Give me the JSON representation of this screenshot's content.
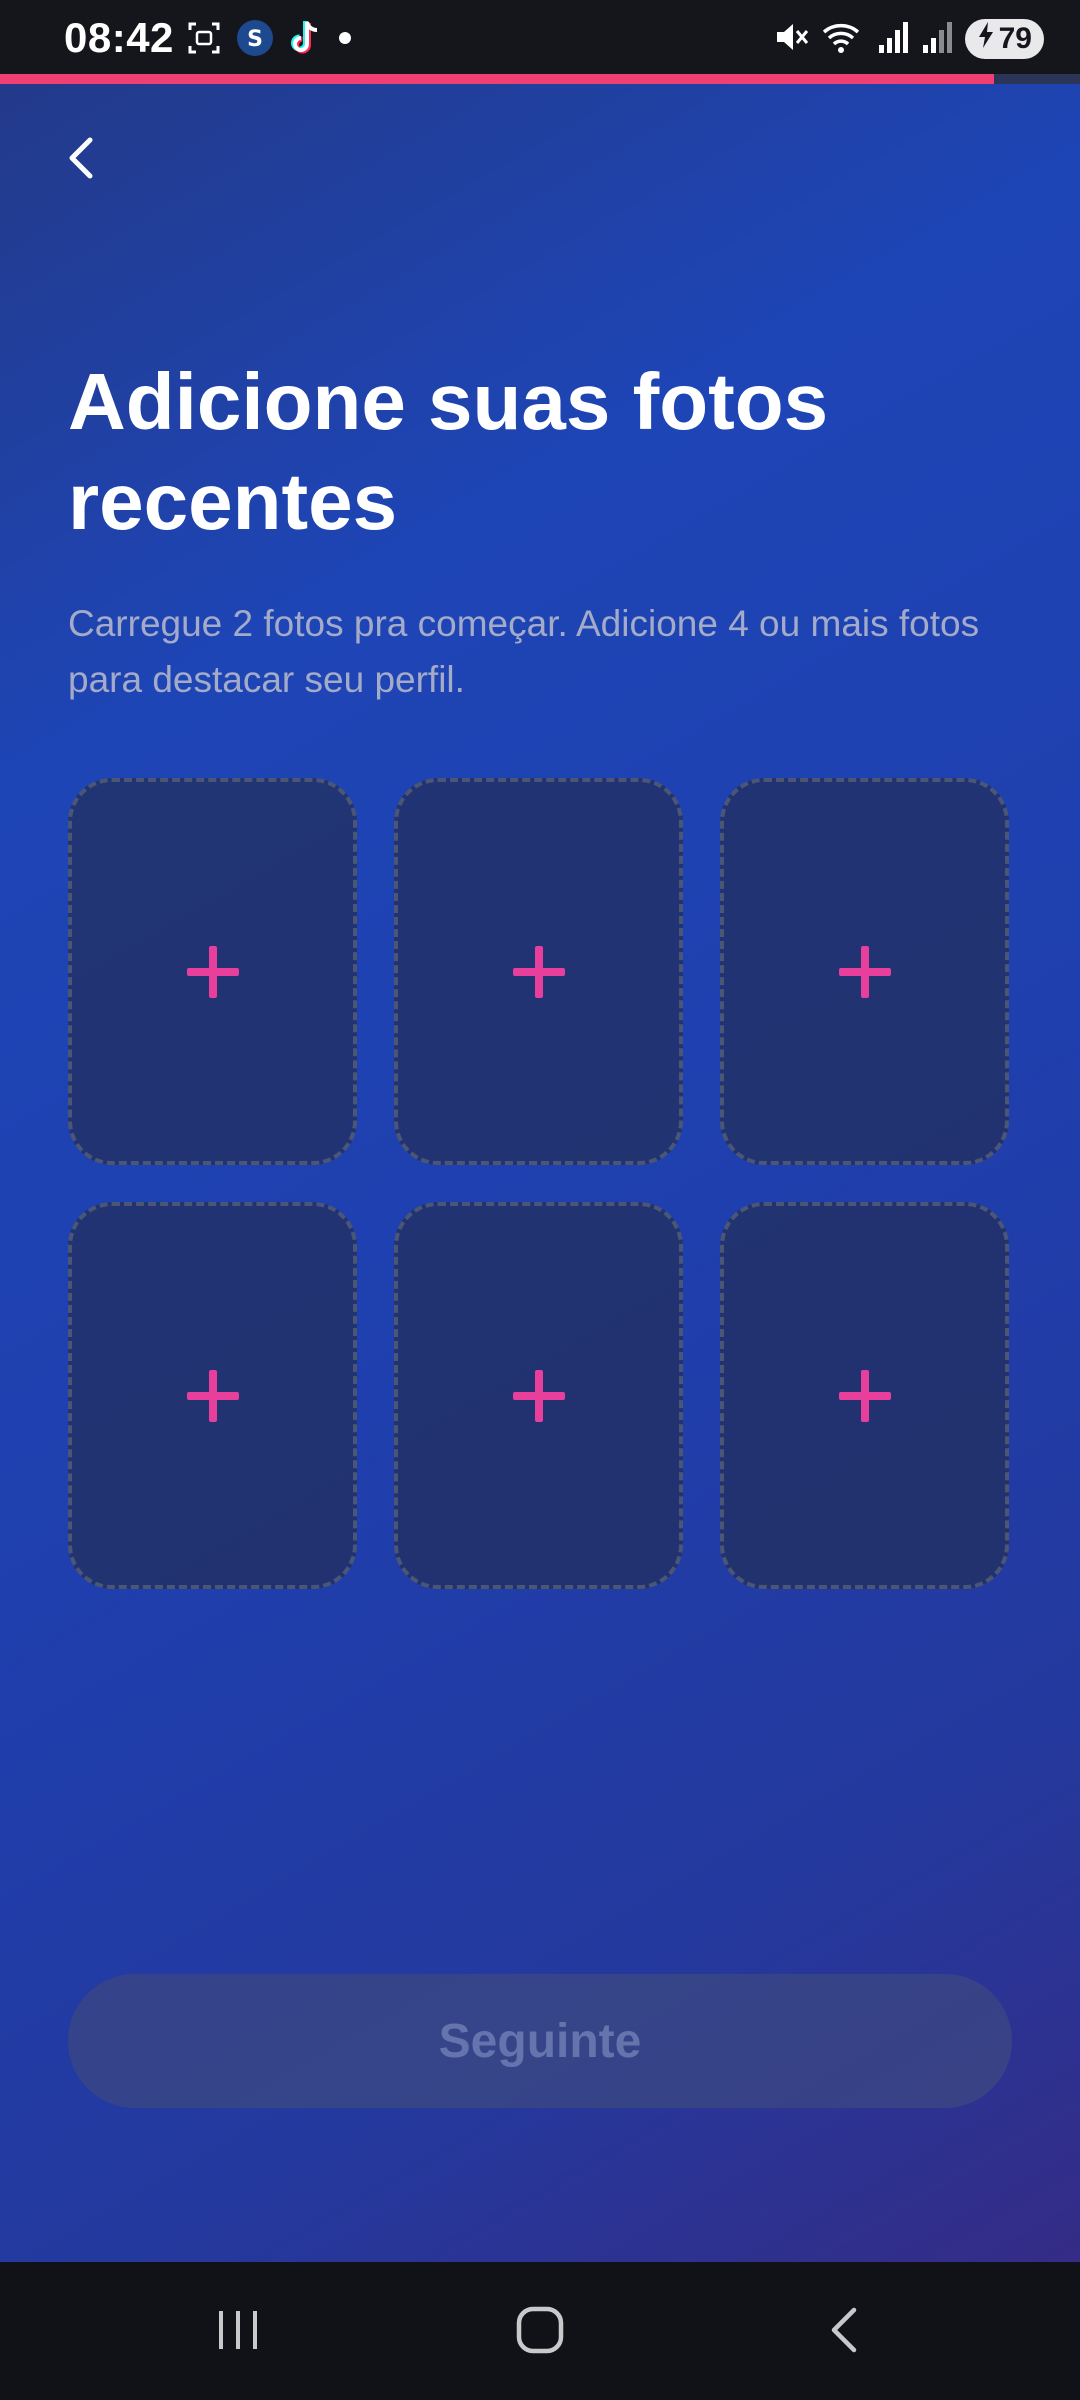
{
  "status_bar": {
    "time": "08:42",
    "battery": "79",
    "icons_left": [
      "screenshot-icon",
      "app-s-icon",
      "tiktok-icon",
      "notification-dot-icon"
    ],
    "icons_right": [
      "mute-icon",
      "wifi-5g-icon",
      "signal-icon",
      "signal-icon",
      "charging-icon"
    ]
  },
  "progress": {
    "fraction": 0.92,
    "color": "#ef3f73"
  },
  "header": {
    "back_icon": "chevron-left-icon"
  },
  "content": {
    "title": "Adicione suas fotos recentes",
    "subtitle": "Carregue 2 fotos pra começar. Adicione 4 ou mais fotos para destacar seu perfil."
  },
  "photo_slots": [
    {
      "icon": "plus-icon"
    },
    {
      "icon": "plus-icon"
    },
    {
      "icon": "plus-icon"
    },
    {
      "icon": "plus-icon"
    },
    {
      "icon": "plus-icon"
    },
    {
      "icon": "plus-icon"
    }
  ],
  "footer": {
    "next_label": "Seguinte"
  },
  "nav": {
    "items": [
      "recent-apps-icon",
      "home-icon",
      "back-icon"
    ]
  },
  "colors": {
    "accent": "#e83e9c",
    "background": "#1e45b6"
  }
}
